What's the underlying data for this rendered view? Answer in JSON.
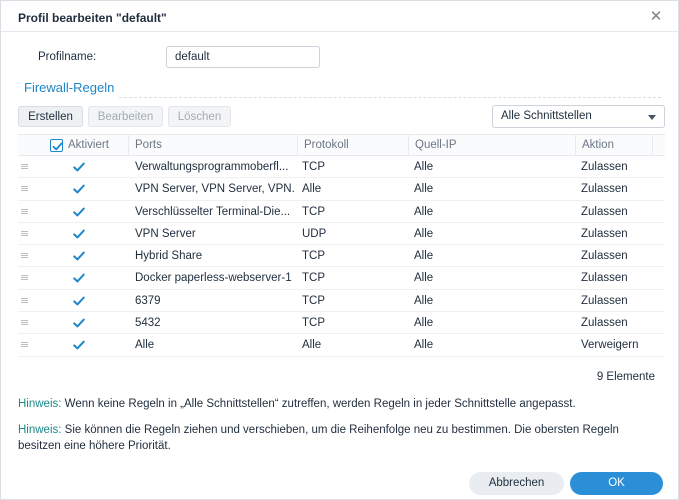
{
  "dialog": {
    "title": "Profil bearbeiten \"default\"",
    "close_glyph": "✕"
  },
  "profile": {
    "name_label": "Profilname:",
    "name_value": "default"
  },
  "section": {
    "title": "Firewall-Regeln"
  },
  "toolbar": {
    "create_label": "Erstellen",
    "edit_label": "Bearbeiten",
    "delete_label": "Löschen",
    "interface_select": "Alle Schnittstellen"
  },
  "table": {
    "headers": {
      "enabled": "Aktiviert",
      "ports": "Ports",
      "protocol": "Protokoll",
      "source_ip": "Quell-IP",
      "action": "Aktion"
    },
    "rows": [
      {
        "enabled": true,
        "ports": "Verwaltungsprogrammoberfl...",
        "protocol": "TCP",
        "source_ip": "Alle",
        "action": "Zulassen"
      },
      {
        "enabled": true,
        "ports": "VPN Server, VPN Server, VPN...",
        "protocol": "Alle",
        "source_ip": "Alle",
        "action": "Zulassen"
      },
      {
        "enabled": true,
        "ports": "Verschlüsselter Terminal-Die...",
        "protocol": "TCP",
        "source_ip": "Alle",
        "action": "Zulassen"
      },
      {
        "enabled": true,
        "ports": "VPN Server",
        "protocol": "UDP",
        "source_ip": "Alle",
        "action": "Zulassen"
      },
      {
        "enabled": true,
        "ports": "Hybrid Share",
        "protocol": "TCP",
        "source_ip": "Alle",
        "action": "Zulassen"
      },
      {
        "enabled": true,
        "ports": "Docker paperless-webserver-1",
        "protocol": "TCP",
        "source_ip": "Alle",
        "action": "Zulassen"
      },
      {
        "enabled": true,
        "ports": "6379",
        "protocol": "TCP",
        "source_ip": "Alle",
        "action": "Zulassen"
      },
      {
        "enabled": true,
        "ports": "5432",
        "protocol": "TCP",
        "source_ip": "Alle",
        "action": "Zulassen"
      },
      {
        "enabled": true,
        "ports": "Alle",
        "protocol": "Alle",
        "source_ip": "Alle",
        "action": "Verweigern"
      }
    ],
    "count_text": "9 Elemente"
  },
  "hints": {
    "label": "Hinweis:",
    "hint1": "Wenn keine Regeln in „Alle Schnittstellen“ zutreffen, werden Regeln in jeder Schnittstelle angepasst.",
    "hint2": "Sie können die Regeln ziehen und verschieben, um die Reihenfolge neu zu bestimmen. Die obersten Regeln besitzen eine höhere Priorität."
  },
  "footer": {
    "cancel_label": "Abbrechen",
    "ok_label": "OK"
  },
  "colors": {
    "accent": "#1f86c8",
    "primary_button": "#2b8fd8",
    "hint_label": "#1a8a8a"
  }
}
